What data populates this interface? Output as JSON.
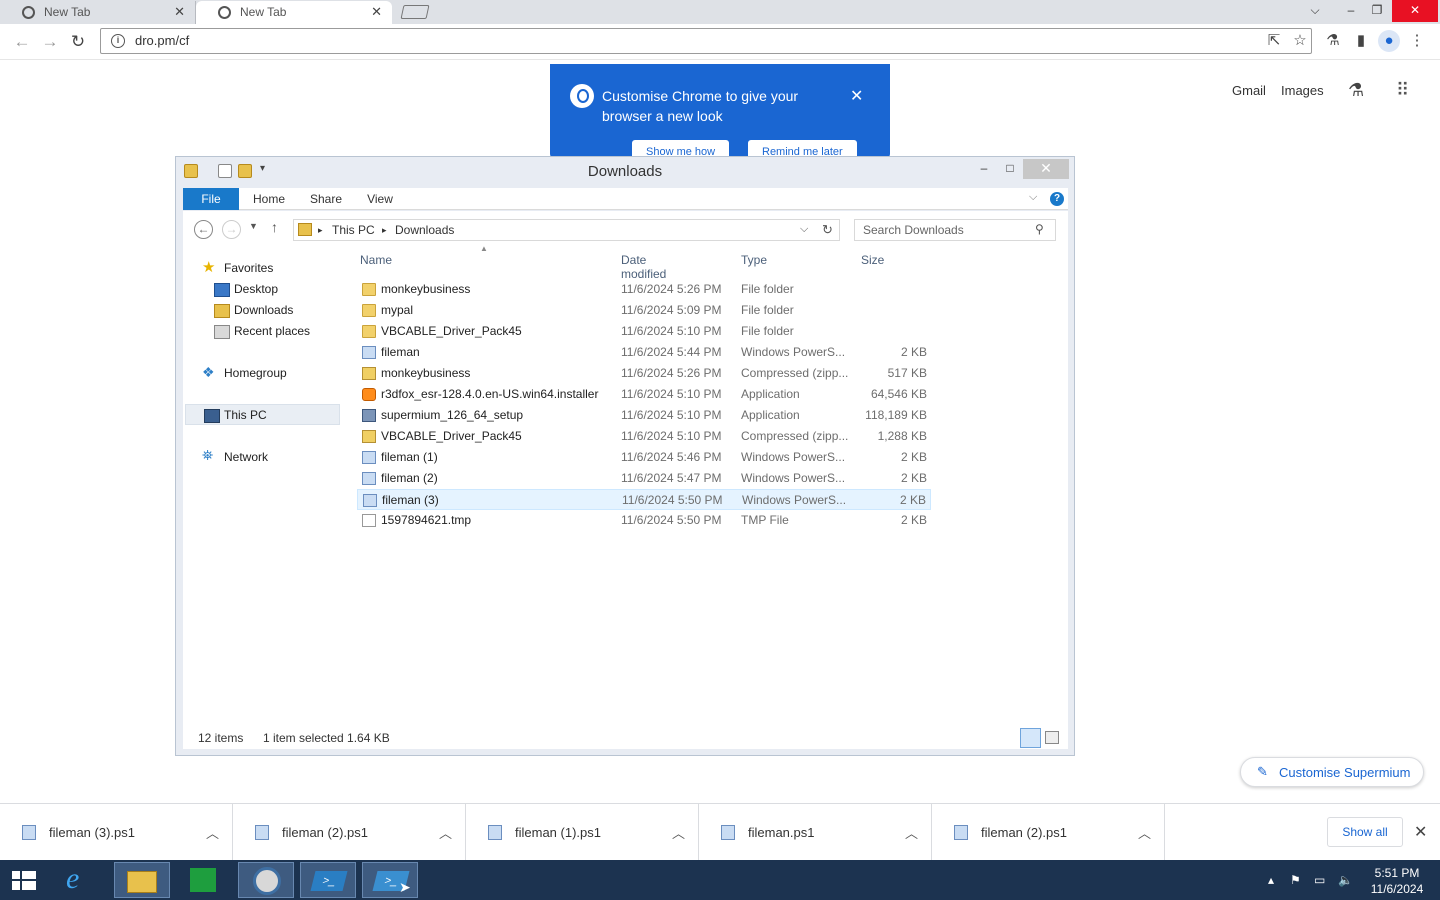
{
  "browser": {
    "tabs": [
      {
        "title": "New Tab"
      },
      {
        "title": "New Tab"
      }
    ],
    "url": "dro.pm/cf",
    "ntp_links": {
      "gmail": "Gmail",
      "images": "Images"
    },
    "promo": {
      "text": "Customise Chrome to give your browser a new look",
      "show_me_how": "Show me how",
      "remind_later": "Remind me later"
    },
    "customise_button": "Customise Supermium"
  },
  "explorer": {
    "title": "Downloads",
    "ribbon_tabs": [
      "File",
      "Home",
      "Share",
      "View"
    ],
    "breadcrumb": [
      "This PC",
      "Downloads"
    ],
    "search_placeholder": "Search Downloads",
    "nav": {
      "favorites": "Favorites",
      "desktop": "Desktop",
      "downloads": "Downloads",
      "recent": "Recent places",
      "homegroup": "Homegroup",
      "thispc": "This PC",
      "network": "Network"
    },
    "columns": {
      "name": "Name",
      "date": "Date modified",
      "type": "Type",
      "size": "Size"
    },
    "files": [
      {
        "name": "monkeybusiness",
        "date": "11/6/2024 5:26 PM",
        "type": "File folder",
        "size": "",
        "icon": "folder-icon"
      },
      {
        "name": "mypal",
        "date": "11/6/2024 5:09 PM",
        "type": "File folder",
        "size": "",
        "icon": "folder-icon"
      },
      {
        "name": "VBCABLE_Driver_Pack45",
        "date": "11/6/2024 5:10 PM",
        "type": "File folder",
        "size": "",
        "icon": "folder-icon"
      },
      {
        "name": "fileman",
        "date": "11/6/2024 5:44 PM",
        "type": "Windows PowerS...",
        "size": "2 KB",
        "icon": "powershell-file-icon"
      },
      {
        "name": "monkeybusiness",
        "date": "11/6/2024 5:26 PM",
        "type": "Compressed (zipp...",
        "size": "517 KB",
        "icon": "zip-folder-icon"
      },
      {
        "name": "r3dfox_esr-128.4.0.en-US.win64.installer",
        "date": "11/6/2024 5:10 PM",
        "type": "Application",
        "size": "64,546 KB",
        "icon": "installer-icon"
      },
      {
        "name": "supermium_126_64_setup",
        "date": "11/6/2024 5:10 PM",
        "type": "Application",
        "size": "118,189 KB",
        "icon": "setup-app-icon"
      },
      {
        "name": "VBCABLE_Driver_Pack45",
        "date": "11/6/2024 5:10 PM",
        "type": "Compressed (zipp...",
        "size": "1,288 KB",
        "icon": "zip-folder-icon"
      },
      {
        "name": "fileman (1)",
        "date": "11/6/2024 5:46 PM",
        "type": "Windows PowerS...",
        "size": "2 KB",
        "icon": "powershell-file-icon"
      },
      {
        "name": "fileman (2)",
        "date": "11/6/2024 5:47 PM",
        "type": "Windows PowerS...",
        "size": "2 KB",
        "icon": "powershell-file-icon"
      },
      {
        "name": "fileman (3)",
        "date": "11/6/2024 5:50 PM",
        "type": "Windows PowerS...",
        "size": "2 KB",
        "icon": "powershell-file-icon",
        "selected": true
      },
      {
        "name": "1597894621.tmp",
        "date": "11/6/2024 5:50 PM",
        "type": "TMP File",
        "size": "2 KB",
        "icon": "tmp-file-icon"
      }
    ],
    "status": {
      "count": "12 items",
      "selection": "1 item selected  1.64 KB"
    }
  },
  "downloads_shelf": {
    "items": [
      "fileman (3).ps1",
      "fileman (2).ps1",
      "fileman (1).ps1",
      "fileman.ps1",
      "fileman (2).ps1"
    ],
    "show_all": "Show all"
  },
  "taskbar": {
    "time": "5:51 PM",
    "date": "11/6/2024"
  }
}
